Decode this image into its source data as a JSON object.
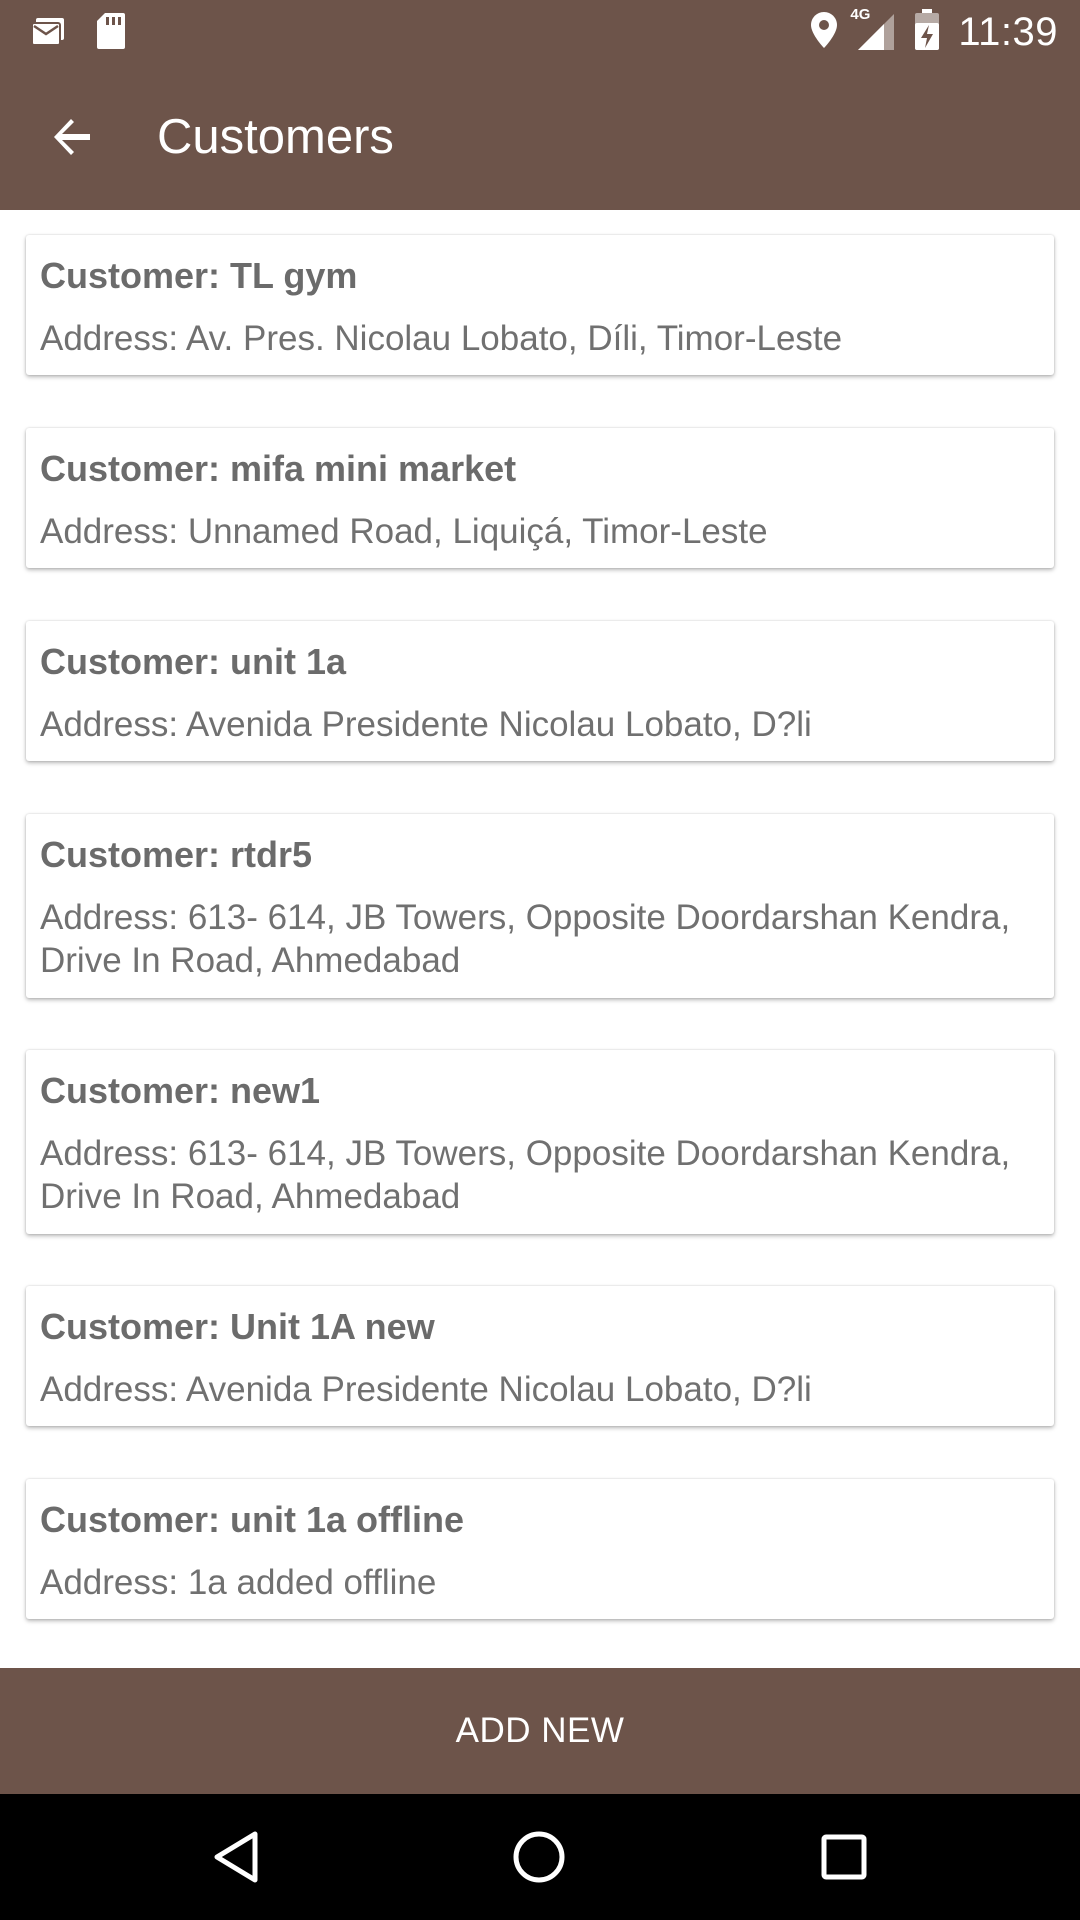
{
  "status_bar": {
    "time": "11:39",
    "network": "4G",
    "icons": [
      "mail-icon",
      "sd-card-icon",
      "location-icon",
      "signal-icon",
      "battery-icon"
    ]
  },
  "app_bar": {
    "title": "Customers",
    "back_icon": "arrow-back-icon"
  },
  "customers": [
    {
      "name": "Customer: TL gym",
      "address": "Address: Av. Pres. Nicolau Lobato, Díli, Timor-Leste"
    },
    {
      "name": "Customer: mifa mini market",
      "address": "Address: Unnamed Road, Liquiçá, Timor-Leste"
    },
    {
      "name": "Customer: unit 1a",
      "address": "Address: Avenida Presidente Nicolau Lobato, D?li"
    },
    {
      "name": "Customer: rtdr5",
      "address": "Address: 613- 614, JB Towers, Opposite Doordarshan Kendra, Drive In Road, Ahmedabad"
    },
    {
      "name": "Customer: new1",
      "address": "Address: 613- 614, JB Towers, Opposite Doordarshan Kendra, Drive In Road, Ahmedabad"
    },
    {
      "name": "Customer: Unit 1A new",
      "address": "Address: Avenida Presidente Nicolau Lobato, D?li"
    },
    {
      "name": "Customer: unit 1a offline",
      "address": "Address: 1a added offline"
    }
  ],
  "footer": {
    "add_new_label": "ADD NEW"
  },
  "nav_bar": {
    "icons": [
      "back-triangle-icon",
      "home-circle-icon",
      "recents-square-icon"
    ]
  },
  "colors": {
    "primary": "#6d544a",
    "card_text": "#6b6b6b",
    "nav_bar": "#000000"
  }
}
